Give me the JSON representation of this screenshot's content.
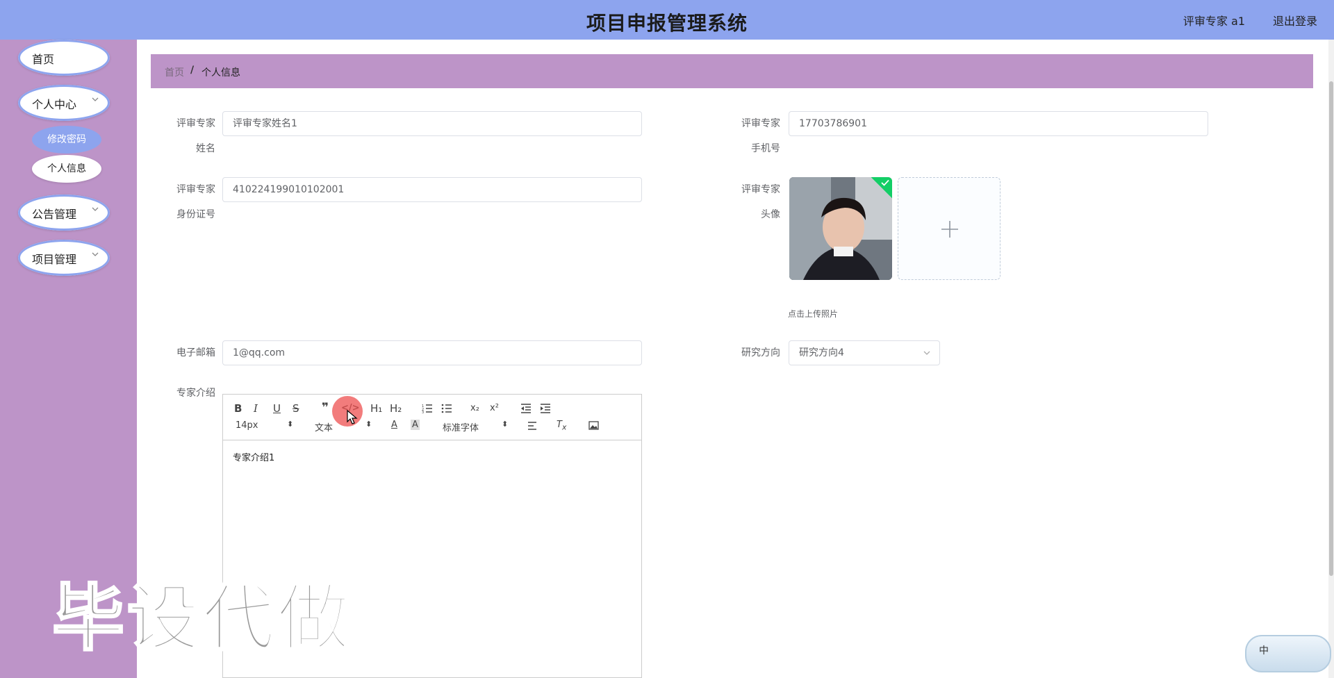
{
  "header": {
    "title": "项目申报管理系统",
    "user": "评审专家 a1",
    "logout": "退出登录"
  },
  "sidebar": {
    "items": [
      {
        "label": "首页"
      },
      {
        "label": "个人中心"
      },
      {
        "label": "公告管理"
      },
      {
        "label": "项目管理"
      }
    ],
    "sub_items": [
      {
        "label": "修改密码"
      },
      {
        "label": "个人信息"
      }
    ]
  },
  "breadcrumb": {
    "home": "首页",
    "separator": "/",
    "current": "个人信息"
  },
  "form": {
    "name_label_1": "评审专家",
    "name_label_2": "姓名",
    "name_value": "评审专家姓名1",
    "phone_label_1": "评审专家",
    "phone_label_2": "手机号",
    "phone_value": "17703786901",
    "id_label_1": "评审专家",
    "id_label_2": "身份证号",
    "id_value": "410224199010102001",
    "avatar_label_1": "评审专家",
    "avatar_label_2": "头像",
    "upload_tip": "点击上传照片",
    "upload_plus": "+",
    "email_label": "电子邮箱",
    "email_value": "1@qq.com",
    "direction_label": "研究方向",
    "direction_value": "研究方向4",
    "intro_label": "专家介绍"
  },
  "editor": {
    "bold": "B",
    "italic": "I",
    "underline": "U",
    "strike": "S",
    "quote": "❞",
    "code": "</>",
    "h1": "H₁",
    "h2": "H₂",
    "subscript": "x₂",
    "superscript": "x²",
    "font_size": "14px",
    "text_type": "文本",
    "font_family": "标准字体",
    "content": "专家介绍1"
  },
  "watermark": "毕设代做",
  "ime": "中",
  "colors": {
    "header_bg": "#8da4ee",
    "sidebar_bg": "#bd94c8",
    "active_sub": "#8da4ee",
    "success": "#13ce66"
  }
}
